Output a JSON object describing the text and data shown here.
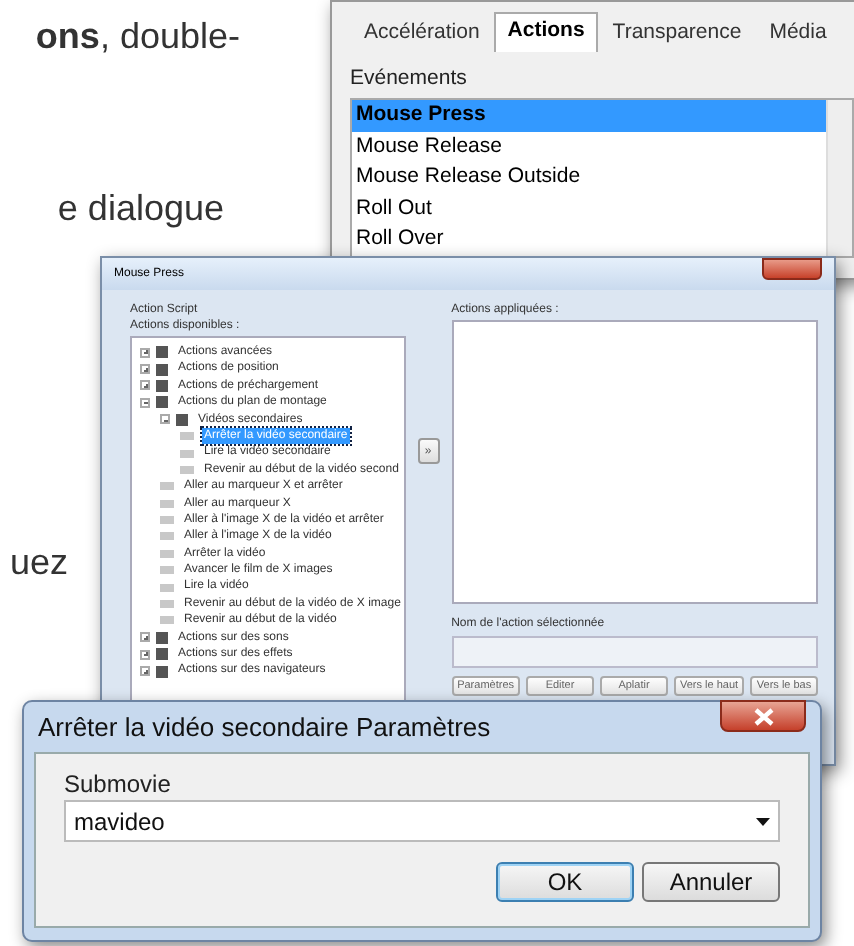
{
  "document_text": [
    "**ons**, double-",
    "e dialogue",
    "uez"
  ],
  "properties_panel": {
    "tabs": [
      {
        "label": "Accélération",
        "selected": false
      },
      {
        "label": "Actions",
        "selected": true
      },
      {
        "label": "Transparence",
        "selected": false
      },
      {
        "label": "Média",
        "selected": false
      }
    ],
    "events_label": "Evénements",
    "events": [
      {
        "label": "Mouse Press",
        "selected": true
      },
      {
        "label": "Mouse Release",
        "selected": false
      },
      {
        "label": "Mouse Release Outside",
        "selected": false
      },
      {
        "label": "Roll Out",
        "selected": false
      },
      {
        "label": "Roll Over",
        "selected": false
      }
    ]
  },
  "action_dialog": {
    "title": "Mouse Press",
    "section_label": "Action Script",
    "available_label": "Actions disponibles :",
    "tree": [
      {
        "label": "Actions avancées",
        "expanded": false,
        "selected": false
      },
      {
        "label": "Actions de position",
        "expanded": false,
        "selected": false
      },
      {
        "label": "Actions de préchargement",
        "expanded": false,
        "selected": false
      },
      {
        "label": "Actions du plan de montage",
        "expanded": true,
        "selected": false,
        "children": [
          {
            "label": "Vidéos secondaires",
            "expanded": true,
            "selected": false,
            "children": [
              {
                "label": "Arrêter la vidéo secondaire",
                "selected": true
              },
              {
                "label": "Lire la vidéo secondaire",
                "selected": false
              },
              {
                "label": "Revenir au début de la vidéo second",
                "selected": false
              }
            ]
          },
          {
            "label": "Aller au marqueur X et arrêter",
            "selected": false
          },
          {
            "label": "Aller au marqueur X",
            "selected": false
          },
          {
            "label": "Aller à l'image X de la vidéo et arrêter",
            "selected": false
          },
          {
            "label": "Aller à l'image X de la vidéo",
            "selected": false
          },
          {
            "label": "Arrêter la vidéo",
            "selected": false
          },
          {
            "label": "Avancer le film de X images",
            "selected": false
          },
          {
            "label": "Lire la vidéo",
            "selected": false
          },
          {
            "label": "Revenir au début de la vidéo de X image",
            "selected": false
          },
          {
            "label": "Revenir au début de la vidéo",
            "selected": false
          }
        ]
      },
      {
        "label": "Actions sur des sons",
        "expanded": false,
        "selected": false
      },
      {
        "label": "Actions sur des effets",
        "expanded": false,
        "selected": false
      },
      {
        "label": "Actions sur des navigateurs",
        "expanded": false,
        "selected": false
      }
    ],
    "add_button": "»",
    "applied_label": "Actions appliquées :",
    "name_label": "Nom de l'action sélectionnée",
    "buttons": [
      "Paramètres",
      "Editer",
      "Aplatir",
      "Vers le haut",
      "Vers le bas"
    ]
  },
  "params_dialog": {
    "title": "Arrêter la vidéo secondaire Paramètres",
    "field_label": "Submovie",
    "value": "mavideo",
    "buttons": [
      {
        "label": "OK",
        "default": true
      },
      {
        "label": "Annuler",
        "default": false
      }
    ]
  }
}
